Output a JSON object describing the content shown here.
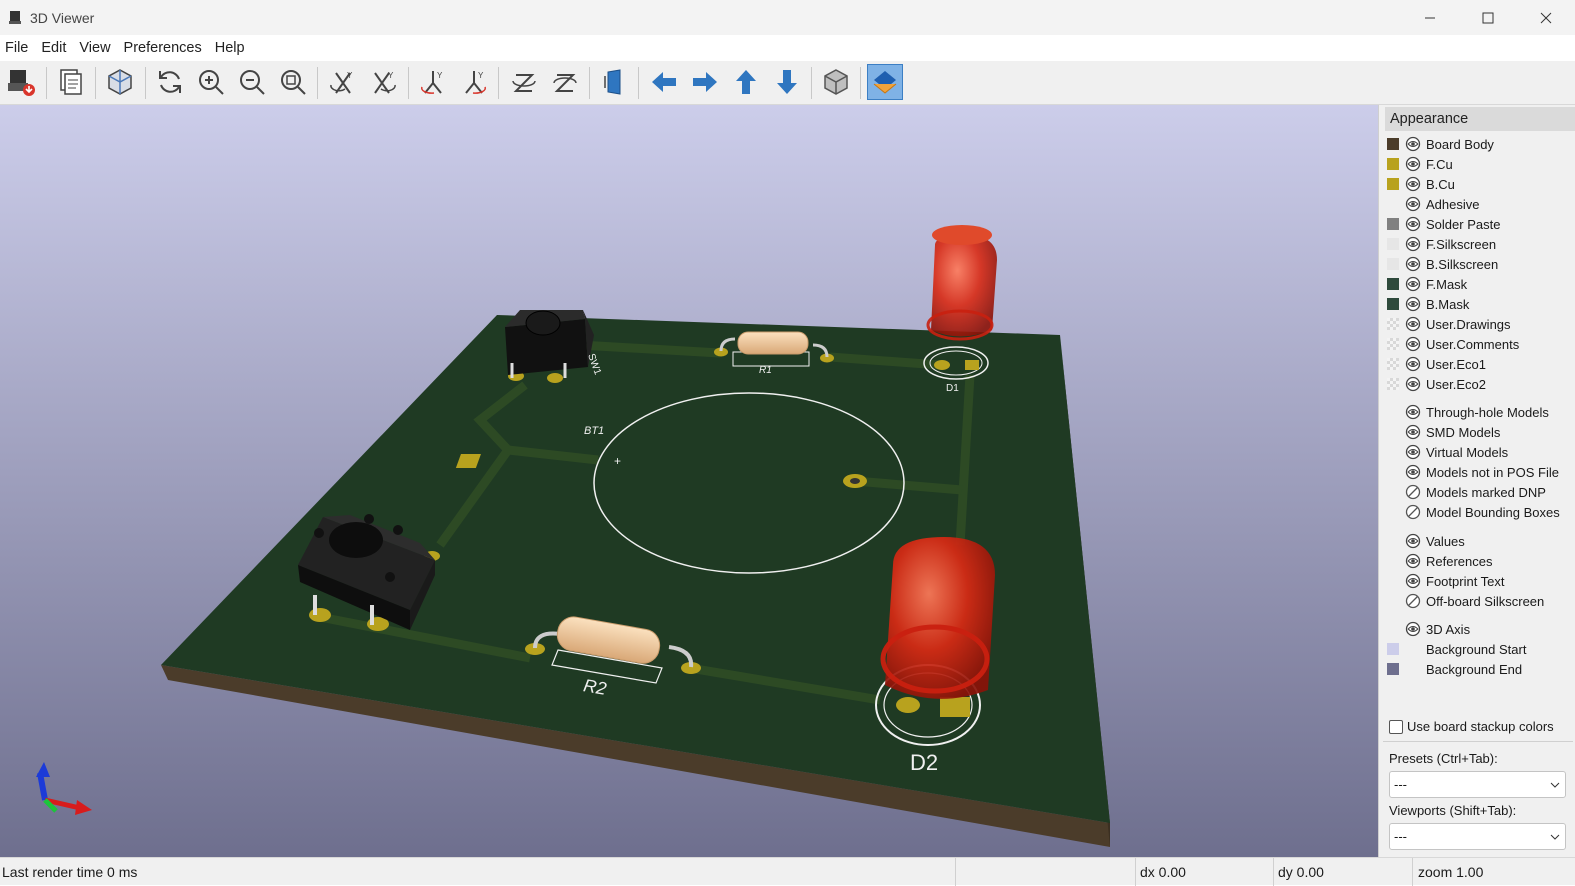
{
  "window": {
    "title": "3D Viewer",
    "controls": [
      "minimize-icon",
      "maximize-icon",
      "close-icon"
    ]
  },
  "menu": [
    "File",
    "Edit",
    "View",
    "Preferences",
    "Help"
  ],
  "toolbar": {
    "tools": [
      "export-image-icon",
      "copy-image-icon",
      "raytrace-icon",
      "reload-icon",
      "zoom-in-icon",
      "zoom-out-icon",
      "zoom-fit-icon",
      "rotate-x-cw-icon",
      "rotate-x-ccw-icon",
      "rotate-y-cw-icon",
      "rotate-y-ccw-icon",
      "rotate-z-cw-icon",
      "rotate-z-ccw-icon",
      "flip-board-icon",
      "move-left-icon",
      "move-right-icon",
      "move-up-icon",
      "move-down-icon",
      "ortho-view-icon",
      "toggle-layers-icon"
    ],
    "active": "toggle-layers-icon"
  },
  "board": {
    "labels": {
      "sw1": "SW1",
      "r1": "R1",
      "d1": "D1",
      "bt1": "BT1",
      "plus": "+",
      "r2": "R2",
      "d2": "D2"
    },
    "colors": {
      "board": "#1f3a23",
      "silk": "#f0f0f0",
      "copper": "#b8a21e",
      "led": "#d92a14",
      "bg_start": "#cccdea",
      "bg_end": "#6e6f8e"
    }
  },
  "appearance": {
    "title": "Appearance",
    "layers": [
      {
        "name": "Board Body",
        "color": "#4b3c2a",
        "vis": "eye"
      },
      {
        "name": "F.Cu",
        "color": "#b8a21e",
        "vis": "eye"
      },
      {
        "name": "B.Cu",
        "color": "#b8a21e",
        "vis": "eye"
      },
      {
        "name": "Adhesive",
        "color": "",
        "vis": "eye"
      },
      {
        "name": "Solder Paste",
        "color": "#808080",
        "vis": "eye"
      },
      {
        "name": "F.Silkscreen",
        "color": "#e6e6e6",
        "vis": "eye"
      },
      {
        "name": "B.Silkscreen",
        "color": "#e6e6e6",
        "vis": "eye"
      },
      {
        "name": "F.Mask",
        "color": "#2e4a3c",
        "vis": "eye"
      },
      {
        "name": "B.Mask",
        "color": "#2e4a3c",
        "vis": "eye"
      },
      {
        "name": "User.Drawings",
        "color": "checker",
        "vis": "eye"
      },
      {
        "name": "User.Comments",
        "color": "checker",
        "vis": "eye"
      },
      {
        "name": "User.Eco1",
        "color": "checker",
        "vis": "eye"
      },
      {
        "name": "User.Eco2",
        "color": "checker",
        "vis": "eye"
      }
    ],
    "models": [
      {
        "name": "Through-hole Models",
        "vis": "eye"
      },
      {
        "name": "SMD Models",
        "vis": "eye"
      },
      {
        "name": "Virtual Models",
        "vis": "eye"
      },
      {
        "name": "Models not in POS File",
        "vis": "eye"
      },
      {
        "name": "Models marked DNP",
        "vis": "hidden"
      },
      {
        "name": "Model Bounding Boxes",
        "vis": "hidden"
      }
    ],
    "text": [
      {
        "name": "Values",
        "vis": "eye"
      },
      {
        "name": "References",
        "vis": "eye"
      },
      {
        "name": "Footprint Text",
        "vis": "eye"
      },
      {
        "name": "Off-board Silkscreen",
        "vis": "hidden"
      }
    ],
    "misc": [
      {
        "name": "3D Axis",
        "vis": "eye",
        "color": ""
      },
      {
        "name": "Background Start",
        "vis": "",
        "color": "#cccdea"
      },
      {
        "name": "Background End",
        "vis": "",
        "color": "#6e6f8e"
      }
    ],
    "use_stackup_label": "Use board stackup colors",
    "use_stackup_checked": false,
    "presets_label": "Presets (Ctrl+Tab):",
    "presets_value": "---",
    "viewports_label": "Viewports (Shift+Tab):",
    "viewports_value": "---"
  },
  "status": {
    "render_time": "Last render time 0 ms",
    "dx": "dx 0.00",
    "dy": "dy 0.00",
    "zoom": "zoom 1.00"
  }
}
